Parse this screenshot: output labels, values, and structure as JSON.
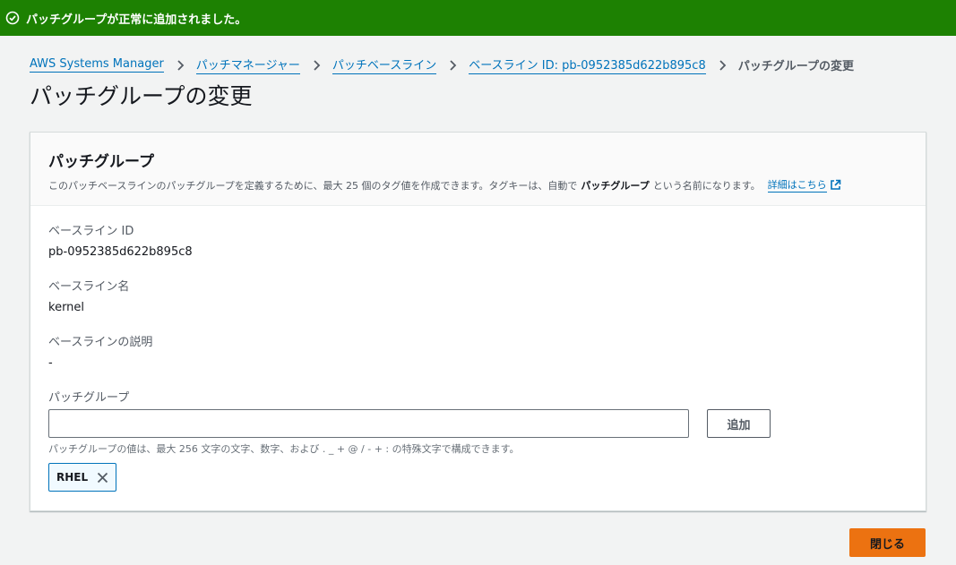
{
  "flash": {
    "message": "パッチグループが正常に追加されました。",
    "icon": "check-circle-icon",
    "color": "#1d8102"
  },
  "breadcrumb": {
    "items": [
      "AWS Systems Manager",
      "パッチマネージャー",
      "パッチベースライン",
      "ベースライン ID: pb-0952385d622b895c8"
    ],
    "current": "パッチグループの変更"
  },
  "page": {
    "title": "パッチグループの変更"
  },
  "card": {
    "title": "パッチグループ",
    "desc_prefix": "このパッチベースラインのパッチグループを定義するために、最大 25 個のタグ値を作成できます。タグキーは、自動で",
    "desc_bold": "パッチグループ",
    "desc_suffix": "という名前になります。",
    "learn_more": "詳細はこちら"
  },
  "fields": {
    "baseline_id_label": "ベースライン ID",
    "baseline_id_value": "pb-0952385d622b895c8",
    "baseline_name_label": "ベースライン名",
    "baseline_name_value": "kernel",
    "baseline_desc_label": "ベースラインの説明",
    "baseline_desc_value": "-",
    "patch_group_label": "パッチグループ"
  },
  "patch_group_input": {
    "value": "",
    "placeholder": ""
  },
  "add_button": "追加",
  "hint": "パッチグループの値は、最大 256 文字の文字、数字、および . _ + @ / - + : の特殊文字で構成できます。",
  "tokens": [
    "RHEL"
  ],
  "close_button": "閉じる",
  "colors": {
    "accent": "#ec7211",
    "link": "#0073bb",
    "success": "#1d8102"
  }
}
